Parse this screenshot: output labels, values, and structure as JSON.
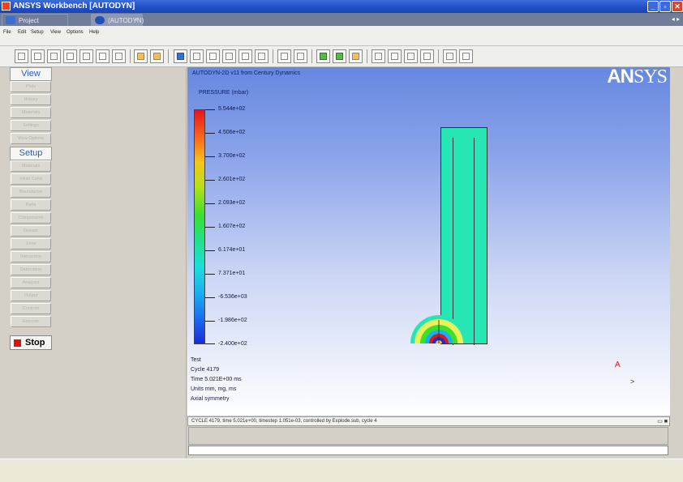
{
  "window": {
    "title": "ANSYS Workbench [AUTODYN]"
  },
  "tabs": [
    {
      "label": "Project"
    },
    {
      "label": "(AUTODYN)"
    }
  ],
  "menu": [
    "File",
    "Edit",
    "Setup",
    "View",
    "Options",
    "Help"
  ],
  "left_panel": {
    "view_header": "View",
    "view_buttons": [
      "Plots",
      "History",
      "Materials",
      "Settings",
      "View Options"
    ],
    "setup_header": "Setup",
    "setup_buttons": [
      "Materials",
      "Initial Cond",
      "Boundaries",
      "Parts",
      "Components",
      "Groups",
      "Joins",
      "Interaction",
      "Detonation",
      "Analysis",
      "Output",
      "Controls",
      "Execute"
    ],
    "stop_label": "Stop"
  },
  "viewport": {
    "title": "AUTODYN-2D v11 from Century Dynamics",
    "logo": "ANSYS",
    "scale_title": "PRESSURE (mbar)",
    "scale_labels": [
      "5.544e+02",
      "4.506e+02",
      "3.700e+02",
      "2.601e+02",
      "2.093e+02",
      "1.607e+02",
      "6.174e+01",
      "7.371e+01",
      "-6.536e+03",
      "-1.986e+02",
      "-2.400e+02"
    ],
    "info_lines": [
      "Test",
      "Cycle 4179",
      "Time 5.021E+00 ms",
      "Units mm, mg, ms",
      "Axial symmetry"
    ],
    "axis_marker": "A"
  },
  "message_bar": {
    "header": "CYCLE 4179, time 5.021e+00, timestep 1.051e-03, controlled by Explode.sub, cycle 4"
  },
  "colors": {
    "scale_top": "#e8141a",
    "scale_bottom": "#1a2cd8",
    "material": "#26e6b4"
  }
}
